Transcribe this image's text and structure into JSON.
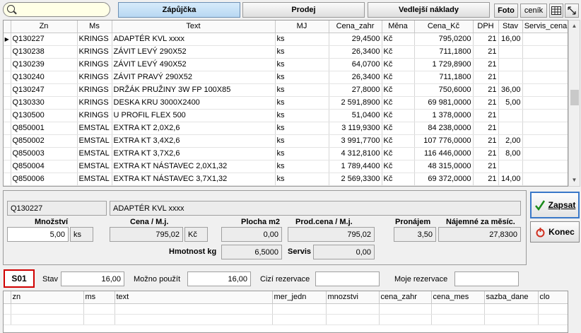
{
  "toolbar": {
    "tab_zapujcka": "Zápůjčka",
    "tab_prodej": "Prodej",
    "tab_vedlejsi": "Vedlejší náklady",
    "foto": "Foto",
    "cenik": "ceník"
  },
  "grid": {
    "columns": [
      "Zn",
      "Ms",
      "Text",
      "MJ",
      "Cena_zahr",
      "Měna",
      "Cena_Kč",
      "DPH",
      "Stav",
      "Servis_cena"
    ],
    "rows": [
      [
        "Q130227",
        "KRINGS",
        "ADAPTÉR KVL xxxx",
        "ks",
        "29,4500",
        "Kč",
        "795,0200",
        "21",
        "16,00",
        ""
      ],
      [
        "Q130238",
        "KRINGS",
        "ZÁVIT LEVÝ 290X52",
        "ks",
        "26,3400",
        "Kč",
        "711,1800",
        "21",
        "",
        ""
      ],
      [
        "Q130239",
        "KRINGS",
        "ZÁVIT LEVÝ 490X52",
        "ks",
        "64,0700",
        "Kč",
        "1 729,8900",
        "21",
        "",
        ""
      ],
      [
        "Q130240",
        "KRINGS",
        "ZÁVIT PRAVÝ 290X52",
        "ks",
        "26,3400",
        "Kč",
        "711,1800",
        "21",
        "",
        ""
      ],
      [
        "Q130247",
        "KRINGS",
        "DRŽÁK PRUŽINY 3W FP 100X85",
        "ks",
        "27,8000",
        "Kč",
        "750,6000",
        "21",
        "36,00",
        ""
      ],
      [
        "Q130330",
        "KRINGS",
        "DESKA KRU 3000X2400",
        "ks",
        "2 591,8900",
        "Kč",
        "69 981,0000",
        "21",
        "5,00",
        ""
      ],
      [
        "Q130500",
        "KRINGS",
        "U PROFIL FLEX 500",
        "ks",
        "51,0400",
        "Kč",
        "1 378,0000",
        "21",
        "",
        ""
      ],
      [
        "Q850001",
        "EMSTAL",
        "EXTRA KT 2,0X2,6",
        "ks",
        "3 119,9300",
        "Kč",
        "84 238,0000",
        "21",
        "",
        ""
      ],
      [
        "Q850002",
        "EMSTAL",
        "EXTRA KT 3,4X2,6",
        "ks",
        "3 991,7700",
        "Kč",
        "107 776,0000",
        "21",
        "2,00",
        ""
      ],
      [
        "Q850003",
        "EMSTAL",
        "EXTRA KT 3,7X2,6",
        "ks",
        "4 312,8100",
        "Kč",
        "116 446,0000",
        "21",
        "8,00",
        ""
      ],
      [
        "Q850004",
        "EMSTAL",
        "EXTRA KT NÁSTAVEC 2,0X1,32",
        "ks",
        "1 789,4400",
        "Kč",
        "48 315,0000",
        "21",
        "",
        ""
      ],
      [
        "Q850006",
        "EMSTAL",
        "EXTRA KT NÁSTAVEC 3,7X1,32",
        "ks",
        "2 569,3300",
        "Kč",
        "69 372,0000",
        "21",
        "14,00",
        ""
      ],
      [
        "",
        "",
        "",
        "",
        "",
        "",
        "",
        "",
        "",
        ""
      ]
    ]
  },
  "detail": {
    "code": "Q130227",
    "name": "ADAPTÉR KVL xxxx",
    "mnozstvi_label": "Množství",
    "mnozstvi": "5,00",
    "unit": "ks",
    "cena_label": "Cena / M.j.",
    "cena": "795,02",
    "currency": "Kč",
    "plocha_label": "Plocha m2",
    "plocha": "0,00",
    "prodcena_label": "Prod.cena / M.j.",
    "prodcena": "795,02",
    "pronajem_label": "Pronájem",
    "pronajem": "3,50",
    "najemne_label": "Nájemné za měsíc.",
    "najemne": "27,8300",
    "hmotnost_label": "Hmotnost kg",
    "hmotnost": "6,5000",
    "servis_label": "Servis",
    "servis": "0,00"
  },
  "buttons": {
    "zapsat": "Zapsat",
    "konec": "Konec"
  },
  "stock": {
    "warehouse": "S01",
    "stav_label": "Stav",
    "stav": "16,00",
    "mozno_label": "Možno použít",
    "mozno": "16,00",
    "cizi_label": "Cizí rezervace",
    "cizi": "",
    "moje_label": "Moje rezervace",
    "moje": ""
  },
  "lower_grid": {
    "columns": [
      "zn",
      "ms",
      "text",
      "mer_jedn",
      "mnozstvi",
      "cena_zahr",
      "cena_mes",
      "sazba_dane",
      "clo"
    ]
  },
  "colors": {
    "accent_tab": "#c4dff5",
    "warehouse_border": "#d00000",
    "zapsat_check": "#1a8a1a",
    "konec_icon": "#d03020"
  }
}
